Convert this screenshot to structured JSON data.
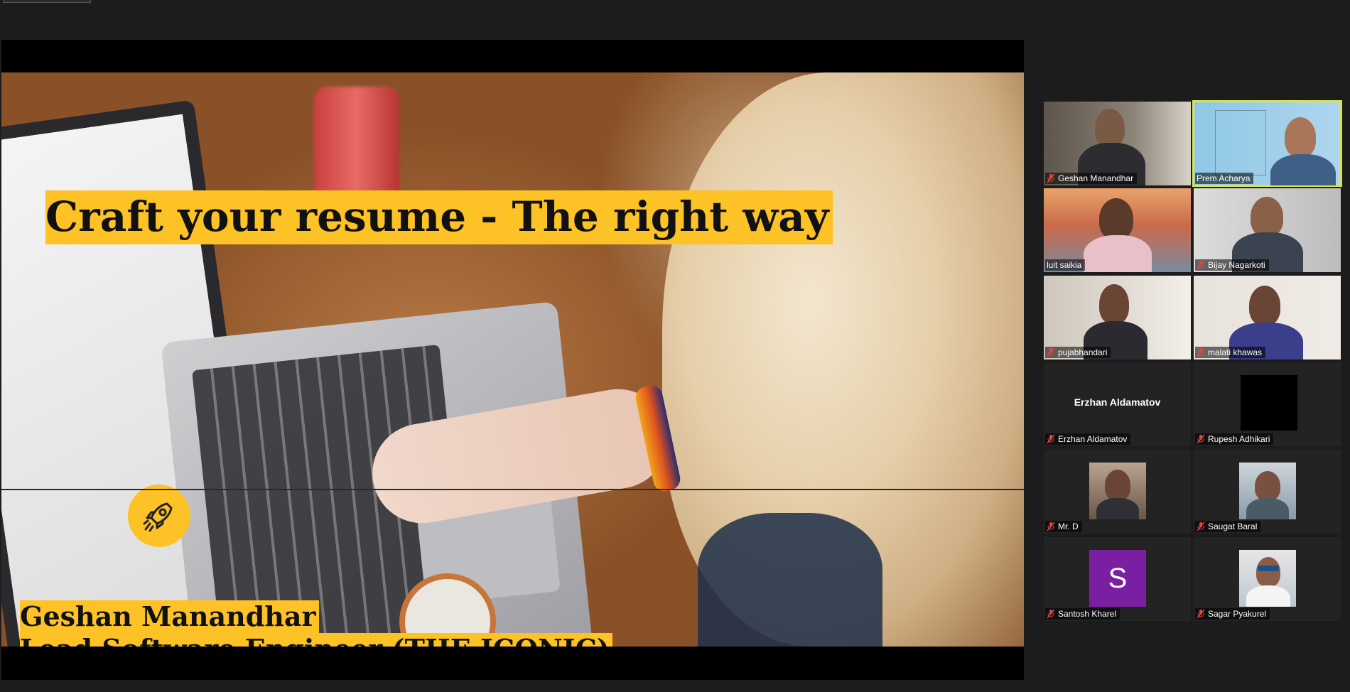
{
  "slide": {
    "title": "Craft your resume - The right way",
    "presenter_name": "Geshan Manandhar",
    "presenter_role": "Lead Software Engineer (THE ICONIC)"
  },
  "participants": [
    {
      "name": "Geshan Manandhar",
      "muted": true,
      "type": "video"
    },
    {
      "name": "Prem Acharya",
      "muted": false,
      "type": "video",
      "active_speaker": true
    },
    {
      "name": "luit saikia",
      "muted": false,
      "type": "video"
    },
    {
      "name": "Bijay Nagarkoti",
      "muted": true,
      "type": "video"
    },
    {
      "name": "pujabhandari",
      "muted": true,
      "type": "video"
    },
    {
      "name": "malati khawas",
      "muted": true,
      "type": "video"
    },
    {
      "name": "Erzhan Aldamatov",
      "muted": true,
      "type": "name-only",
      "center_label": "Erzhan Aldamatov"
    },
    {
      "name": "Rupesh Adhikari",
      "muted": true,
      "type": "black-avatar"
    },
    {
      "name": "Mr. D",
      "muted": true,
      "type": "photo"
    },
    {
      "name": "Saugat Baral",
      "muted": true,
      "type": "photo"
    },
    {
      "name": "Santosh Kharel",
      "muted": true,
      "type": "letter",
      "letter": "S"
    },
    {
      "name": "Sagar Pyakurel",
      "muted": true,
      "type": "photo"
    }
  ],
  "colors": {
    "slide_accent": "#fcc226",
    "active_speaker_border": "#d7e64a",
    "muted_icon": "#e0473e",
    "letter_avatar_bg": "#7b1fa2"
  },
  "icons": {
    "muted": "mic-muted-icon",
    "slide_badge": "rocket-icon"
  }
}
